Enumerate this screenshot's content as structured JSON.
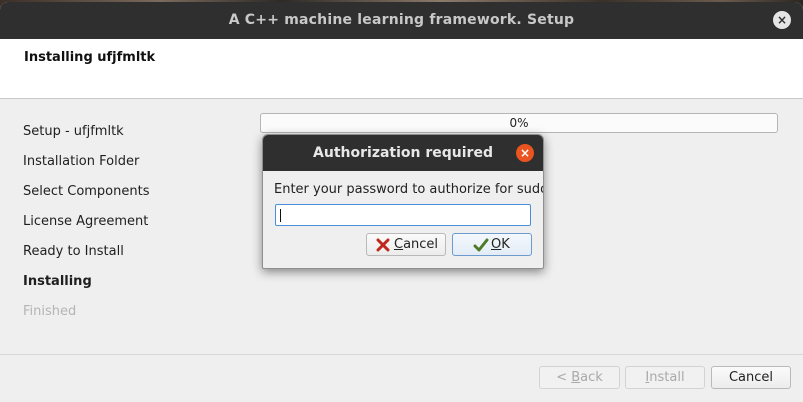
{
  "window": {
    "title": "A C++ machine learning framework. Setup",
    "close_label": "×"
  },
  "header": {
    "title": "Installing ufjfmltk"
  },
  "steps": [
    {
      "label": "Setup - ufjfmltk",
      "state": "done"
    },
    {
      "label": "Installation Folder",
      "state": "done"
    },
    {
      "label": "Select Components",
      "state": "done"
    },
    {
      "label": "License Agreement",
      "state": "done"
    },
    {
      "label": "Ready to Install",
      "state": "done"
    },
    {
      "label": "Installing",
      "state": "current"
    },
    {
      "label": "Finished",
      "state": "future"
    }
  ],
  "progress": {
    "value": 0,
    "text": "0%"
  },
  "footer": {
    "back_label": "< Back",
    "install_label": "Install",
    "cancel_label": "Cancel"
  },
  "dialog": {
    "title": "Authorization required",
    "close_label": "×",
    "prompt": "Enter your password to authorize for sudo:",
    "password_value": "",
    "cancel_label": "Cancel",
    "ok_label": "OK",
    "accent": "#e95420"
  },
  "icons": {
    "cancel": "red-x-icon",
    "ok": "checkmark-icon"
  }
}
